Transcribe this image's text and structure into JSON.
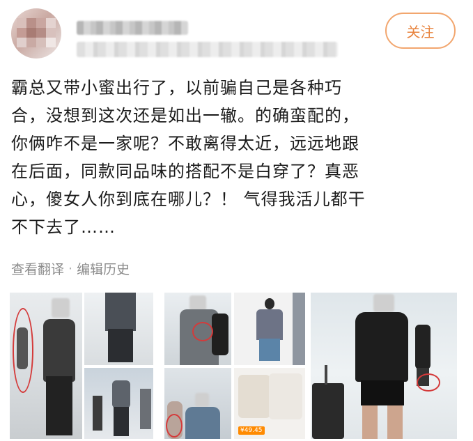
{
  "header": {
    "follow_label": "关注"
  },
  "post": {
    "lines": [
      "霸总又带小蜜出行了，以前骗自己是各种巧",
      "合，没想到这次还是如出一辙。的确蛮配的，",
      "你俩咋不是一家呢？不敢离得太近，远远地跟",
      "在后面，同款同品味的搭配不是白穿了？真恶",
      "心，傻女人你到底在哪儿？！ 气得我活儿都干",
      "不下去了……"
    ]
  },
  "actions": {
    "translate_label": "查看翻译",
    "separator": "·",
    "history_label": "编辑历史"
  },
  "photos": {
    "price_tag": "¥49.45"
  },
  "colors": {
    "accent": "#e8843f",
    "accent_border": "#f2a66e",
    "circle_annotation": "#d43a3a",
    "muted_text": "#8c8c8c"
  }
}
